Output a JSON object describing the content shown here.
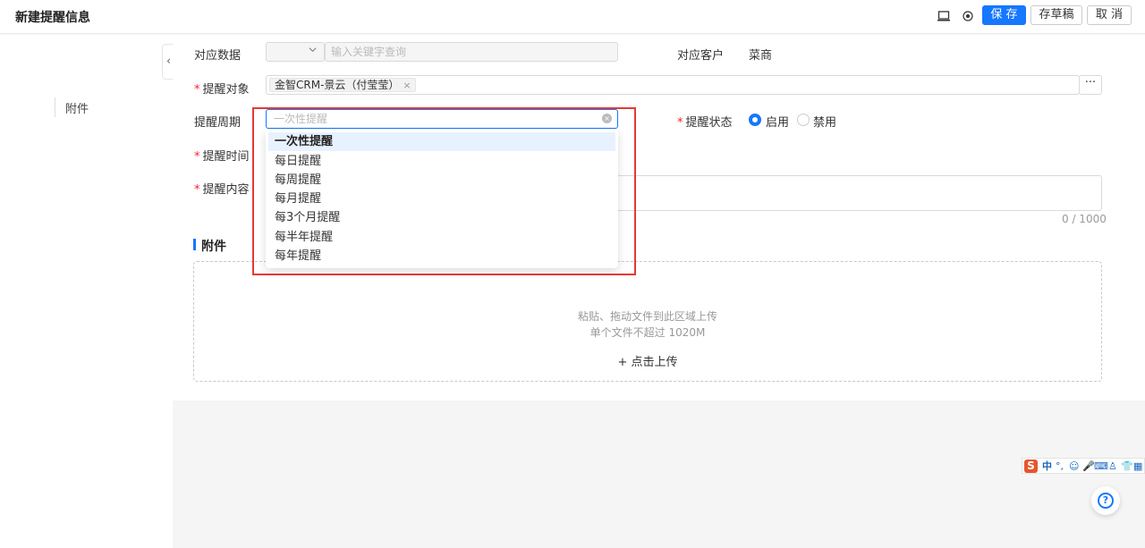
{
  "header": {
    "title": "新建提醒信息",
    "save_label": "保 存",
    "draft_label": "存草稿",
    "cancel_label": "取 消"
  },
  "sidebar": {
    "anchor_label": "附件",
    "collapse_glyph": "‹"
  },
  "form": {
    "related_data": {
      "label": "对应数据",
      "search_placeholder": "输入关键字查询"
    },
    "related_customer": {
      "label": "对应客户",
      "value": "菜商"
    },
    "remind_target": {
      "label": "提醒对象",
      "tag": "金智CRM-景云（付莹莹）",
      "more": "···"
    },
    "remind_period": {
      "label": "提醒周期",
      "placeholder": "一次性提醒"
    },
    "remind_status": {
      "label": "提醒状态",
      "options": [
        "启用",
        "禁用"
      ],
      "selected": "启用"
    },
    "remind_time": {
      "label": "提醒时间"
    },
    "remind_content": {
      "label": "提醒内容",
      "counter": "0 / 1000"
    }
  },
  "attachments": {
    "title": "附件",
    "hint1": "粘贴、拖动文件到此区域上传",
    "hint2": "单个文件不超过 1020M",
    "upload_label": "+ 点击上传"
  },
  "period_dropdown": {
    "options": [
      "一次性提醒",
      "每日提醒",
      "每周提醒",
      "每月提醒",
      "每3个月提醒",
      "每半年提醒",
      "每年提醒"
    ],
    "active": "一次性提醒"
  },
  "ime_toolbar": {
    "logo": "S",
    "lang": "中",
    "items": [
      "°,",
      "☺",
      "🎤",
      "⌨",
      "♙",
      "👕",
      "▦"
    ]
  },
  "help": {
    "glyph": "?"
  },
  "colors": {
    "primary": "#1677ff",
    "required": "#f5222d",
    "highlight": "#e53935"
  }
}
